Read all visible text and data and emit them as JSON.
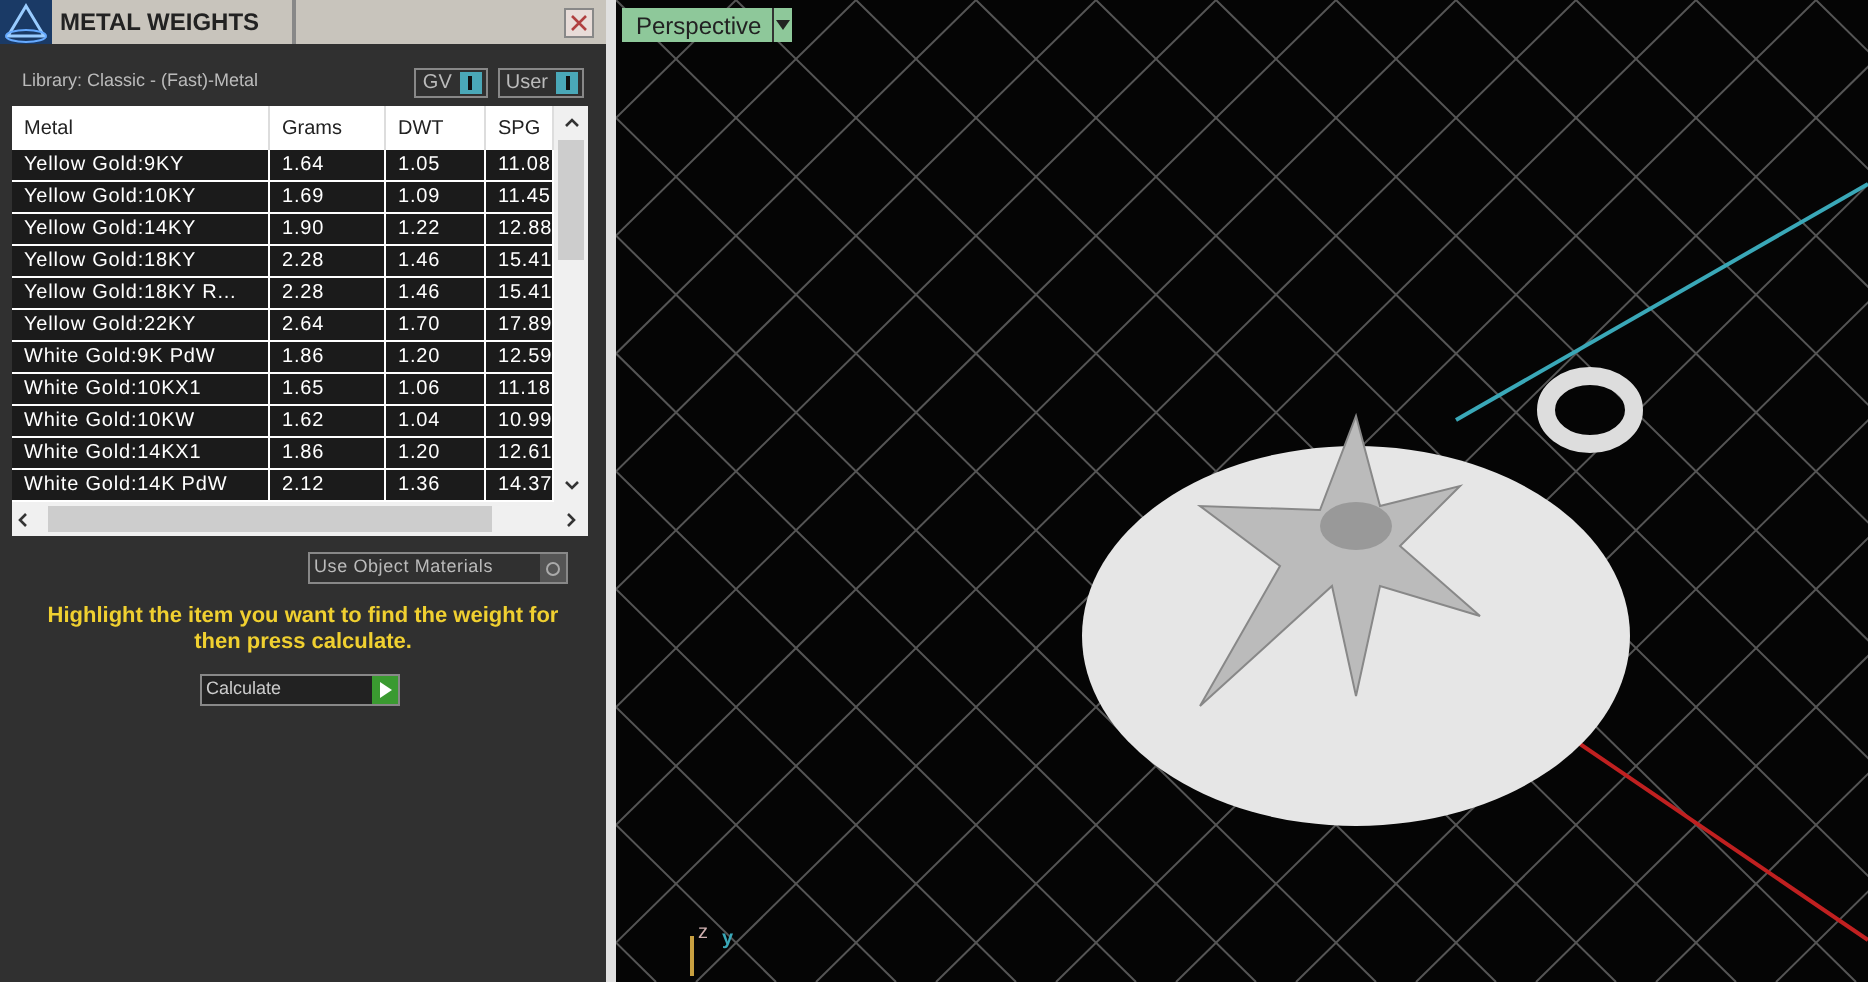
{
  "panel": {
    "title": "METAL WEIGHTS",
    "library": "Library: Classic - (Fast)-Metal",
    "toggles": [
      {
        "label": "GV",
        "on": true
      },
      {
        "label": "User",
        "on": true
      }
    ],
    "table": {
      "columns": [
        "Metal",
        "Grams",
        "DWT",
        "SPG"
      ],
      "rows": [
        [
          "Yellow Gold:9KY",
          "1.64",
          "1.05",
          "11.08"
        ],
        [
          "Yellow Gold:10KY",
          "1.69",
          "1.09",
          "11.45"
        ],
        [
          "Yellow Gold:14KY",
          "1.90",
          "1.22",
          "12.88"
        ],
        [
          "Yellow Gold:18KY",
          "2.28",
          "1.46",
          "15.41"
        ],
        [
          "Yellow Gold:18KY R...",
          "2.28",
          "1.46",
          "15.41"
        ],
        [
          "Yellow Gold:22KY",
          "2.64",
          "1.70",
          "17.89"
        ],
        [
          "White Gold:9K PdW",
          "1.86",
          "1.20",
          "12.59"
        ],
        [
          "White Gold:10KX1",
          "1.65",
          "1.06",
          "11.18"
        ],
        [
          "White Gold:10KW",
          "1.62",
          "1.04",
          "10.99"
        ],
        [
          "White Gold:14KX1",
          "1.86",
          "1.20",
          "12.61"
        ],
        [
          "White Gold:14K PdW",
          "2.12",
          "1.36",
          "14.37"
        ]
      ]
    },
    "use_object_materials": {
      "label": "Use Object Materials",
      "checked": false
    },
    "hint": "Highlight the item you want to find the weight for then press calculate.",
    "calculate": "Calculate"
  },
  "viewport": {
    "view": "Perspective",
    "axes": [
      "z",
      "y"
    ]
  }
}
